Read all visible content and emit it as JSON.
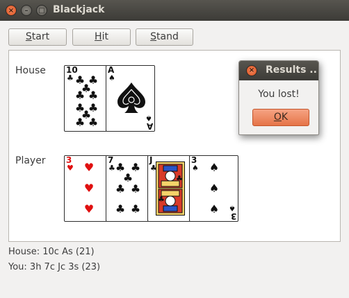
{
  "window": {
    "title": "Blackjack"
  },
  "toolbar": {
    "start_first": "S",
    "start_rest": "tart",
    "hit_first": "H",
    "hit_rest": "it",
    "stand_first": "S",
    "stand_rest": "tand"
  },
  "house": {
    "label": "House",
    "cards": [
      {
        "rank": "10",
        "suit": "♣",
        "color": "#111111"
      },
      {
        "rank": "A",
        "suit": "♠",
        "color": "#111111"
      }
    ]
  },
  "player": {
    "label": "Player",
    "cards": [
      {
        "rank": "3",
        "suit": "♥",
        "color": "#e01010"
      },
      {
        "rank": "7",
        "suit": "♣",
        "color": "#111111"
      },
      {
        "rank": "J",
        "suit": "♣",
        "color": "#111111"
      },
      {
        "rank": "3",
        "suit": "♠",
        "color": "#111111"
      }
    ]
  },
  "status": {
    "house_line": "House:   10c   As   (21)",
    "you_line": "You:   3h   7c   Jc   3s   (23)"
  },
  "dialog": {
    "title": "Results ..",
    "message": "You lost!",
    "ok_first": "O",
    "ok_rest": "K"
  }
}
